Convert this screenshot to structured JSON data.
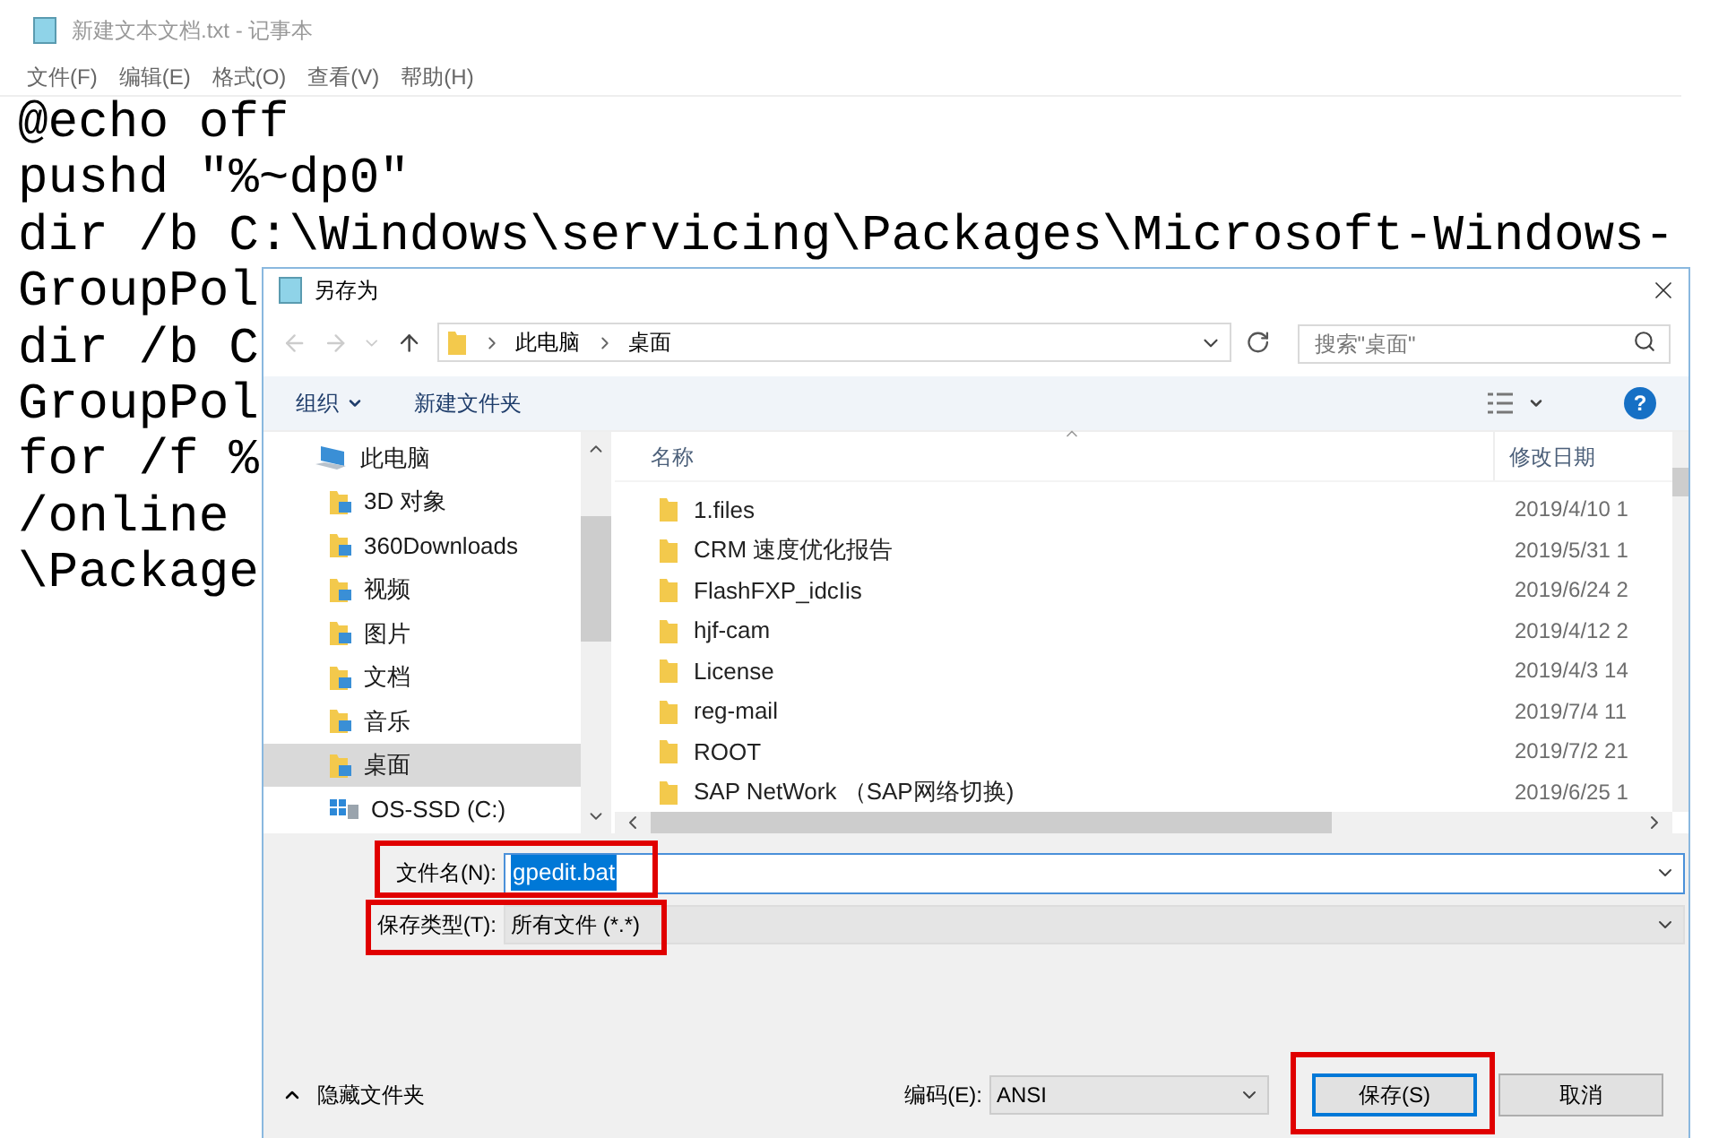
{
  "notepad": {
    "title": "新建文本文档.txt - 记事本",
    "menu": [
      "文件(F)",
      "编辑(E)",
      "格式(O)",
      "查看(V)",
      "帮助(H)"
    ],
    "lines": [
      "@echo off",
      "pushd \"%~dp0\"",
      "dir /b C:\\Windows\\servicing\\Packages\\Microsoft-Windows-",
      "GroupPol",
      "dir /b C",
      "GroupPol",
      "for /f %",
      "/online",
      "\\Package"
    ]
  },
  "dialog": {
    "title": "另存为",
    "breadcrumb": [
      "此电脑",
      "桌面"
    ],
    "search": {
      "placeholder": "搜索\"桌面\""
    },
    "toolbar": {
      "organize": "组织",
      "new_folder": "新建文件夹",
      "help": "?"
    },
    "sidebar": {
      "items": [
        {
          "label": "此电脑",
          "kind": "computer",
          "selected": false,
          "children": [
            {
              "label": "3D 对象",
              "kind": "folder",
              "selected": false
            },
            {
              "label": "360Downloads",
              "kind": "folder",
              "selected": false
            },
            {
              "label": "视频",
              "kind": "folder",
              "selected": false
            },
            {
              "label": "图片",
              "kind": "folder",
              "selected": false
            },
            {
              "label": "文档",
              "kind": "folder",
              "selected": false
            },
            {
              "label": "音乐",
              "kind": "folder",
              "selected": false
            },
            {
              "label": "桌面",
              "kind": "folder",
              "selected": true
            },
            {
              "label": "OS-SSD (C:)",
              "kind": "drive",
              "selected": false
            }
          ]
        }
      ]
    },
    "table": {
      "columns": [
        "名称",
        "修改日期"
      ],
      "rows": [
        {
          "name": "1.files",
          "modified": "2019/4/10 1"
        },
        {
          "name": "CRM 速度优化报告",
          "modified": "2019/5/31 1"
        },
        {
          "name": "FlashFXP_idcIis",
          "modified": "2019/6/24 2"
        },
        {
          "name": "hjf-cam",
          "modified": "2019/4/12 2"
        },
        {
          "name": "License",
          "modified": "2019/4/3 14"
        },
        {
          "name": "reg-mail",
          "modified": "2019/7/4 11"
        },
        {
          "name": "ROOT",
          "modified": "2019/7/2 21"
        },
        {
          "name": "SAP NetWork （SAP网络切换)",
          "modified": "2019/6/25 1"
        }
      ]
    },
    "filename": {
      "label": "文件名(N):",
      "value": "gpedit.bat"
    },
    "filetype": {
      "label": "保存类型(T):",
      "value": "所有文件 (*.*)"
    },
    "hide_folders": "隐藏文件夹",
    "encoding": {
      "label": "编码(E):",
      "value": "ANSI"
    },
    "buttons": [
      {
        "label": "保存(S)",
        "default": true
      },
      {
        "label": "取消",
        "default": false
      }
    ]
  }
}
